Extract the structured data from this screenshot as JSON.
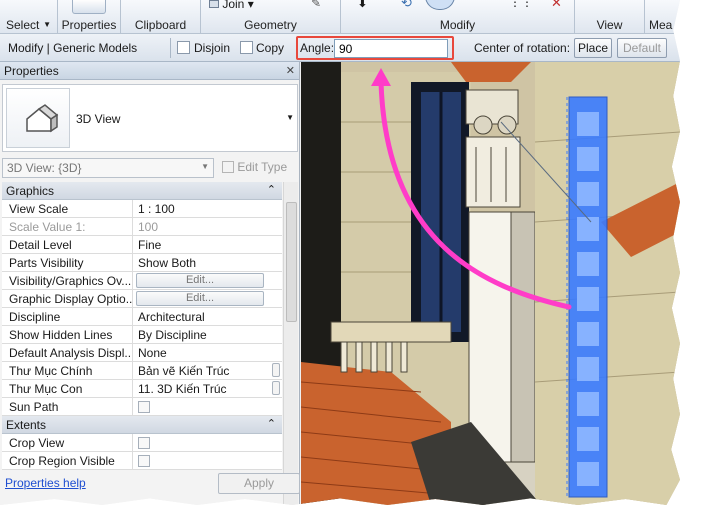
{
  "ribbon": {
    "groups": [
      "Select",
      "Properties",
      "Clipboard",
      "Geometry",
      "Modify",
      "View",
      "Mea"
    ],
    "join_label": "Join"
  },
  "options_bar": {
    "context": "Modify | Generic Models",
    "disjoin_label": "Disjoin",
    "copy_label": "Copy",
    "angle_label": "Angle:",
    "angle_value": "90",
    "center_label": "Center of rotation:",
    "place_label": "Place",
    "default_label": "Default"
  },
  "properties": {
    "title": "Properties",
    "type_name": "3D View",
    "view_selector": "3D View: {3D}",
    "edit_type": "Edit Type",
    "sections": [
      {
        "name": "Graphics",
        "rows": [
          {
            "key": "View Scale",
            "value": "1 : 100"
          },
          {
            "key": "Scale Value    1:",
            "value": "100"
          },
          {
            "key": "Detail Level",
            "value": "Fine"
          },
          {
            "key": "Parts Visibility",
            "value": "Show Both"
          },
          {
            "key": "Visibility/Graphics Ov...",
            "value": "Edit..."
          },
          {
            "key": "Graphic Display Optio...",
            "value": "Edit..."
          },
          {
            "key": "Discipline",
            "value": "Architectural"
          },
          {
            "key": "Show Hidden Lines",
            "value": "By Discipline"
          },
          {
            "key": "Default Analysis Displ...",
            "value": "None"
          },
          {
            "key": "Thư Mục Chính",
            "value": "Bản vẽ Kiến Trúc"
          },
          {
            "key": "Thư Mục Con",
            "value": "11. 3D Kiến Trúc"
          },
          {
            "key": "Sun Path",
            "value": ""
          }
        ]
      },
      {
        "name": "Extents",
        "rows": [
          {
            "key": "Crop View",
            "value": ""
          },
          {
            "key": "Crop Region Visible",
            "value": ""
          }
        ]
      }
    ],
    "help_link": "Properties help",
    "apply_label": "Apply"
  },
  "colors": {
    "accent": "#e8483c",
    "arrow": "#ff3cc8",
    "selection": "#3a7bff"
  }
}
